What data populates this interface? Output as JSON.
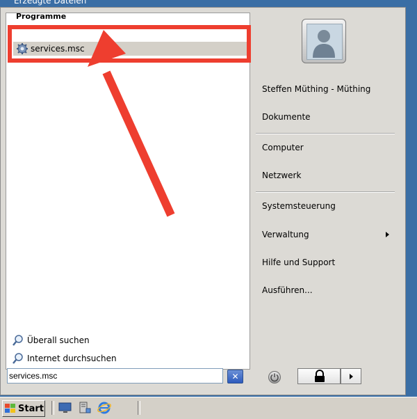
{
  "window": {
    "title": "Erzeugte Dateien"
  },
  "left_pane": {
    "section_header": "Programme",
    "result": {
      "label": "services.msc",
      "icon": "gear-services-icon"
    },
    "search_links": [
      {
        "label": "Überall suchen",
        "icon": "search-icon"
      },
      {
        "label": "Internet durchsuchen",
        "icon": "search-icon"
      }
    ]
  },
  "right_pane": {
    "user_tile_icon": "user-avatar-icon",
    "items": [
      {
        "label": "Steffen Müthing - Müthing"
      },
      {
        "label": "Dokumente"
      },
      {
        "label": "Computer"
      },
      {
        "label": "Netzwerk"
      },
      {
        "label": "Systemsteuerung"
      },
      {
        "label": "Verwaltung",
        "has_submenu": true
      },
      {
        "label": "Hilfe und Support"
      },
      {
        "label": "Ausführen..."
      }
    ]
  },
  "search_box": {
    "value": "services.msc",
    "clear_icon": "close-icon"
  },
  "power": {
    "power_icon": "power-icon",
    "lock_icon": "lock-icon",
    "arrow_icon": "chevron-right-icon"
  },
  "taskbar": {
    "start_label": "Start",
    "quick_launch": [
      "show-desktop-icon",
      "server-manager-icon",
      "internet-explorer-icon"
    ]
  },
  "annotation": {
    "color": "#ee3e2f"
  }
}
